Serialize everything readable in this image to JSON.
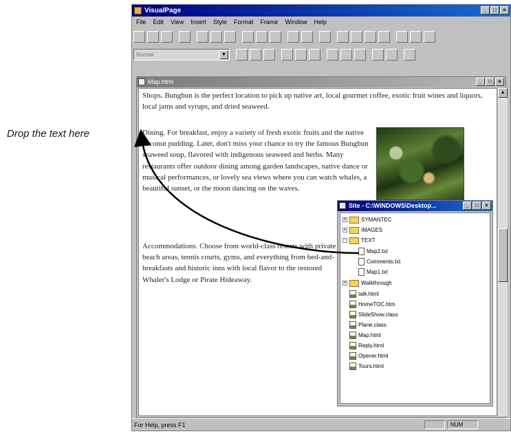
{
  "caption": "Drop the text here",
  "app": {
    "title": "VisualPage",
    "window_buttons": [
      "_",
      "□",
      "×"
    ],
    "menu": [
      "File",
      "Edit",
      "View",
      "Insert",
      "Style",
      "Format",
      "Frame",
      "Window",
      "Help"
    ],
    "style_combo_value": "Normal"
  },
  "document": {
    "title": "Map.html",
    "paragraphs": [
      "Shops. Bungbun is the perfect location to pick up native art, local gourmet coffee, exotic fruit wines and liquors, local jams and syrups, and dried seaweed.",
      "Dining. For breakfast, enjoy a variety of fresh exotic fruits and the native coconut pudding. Later, don't miss your chance to try the famous Bungbun seaweed soup, flavored with indigenous seaweed and herbs. Many restaurants offer outdoor dining among garden landscapes, native dance or musical performances, or lovely sea views where you can watch whales, a beautiful sunset, or the moon dancing on the waves.",
      "Accommodations. Choose from world-class resorts with private beach areas, tennis courts, gyms, and everything from bed-and-breakfasts and historic inns with local flavor to the restored Whaler's Lodge or Pirate Hideaway."
    ]
  },
  "site": {
    "title": "Site - C:\\WINDOWS\\Desktop...",
    "tree": [
      {
        "label": "SYMANTEC",
        "type": "folder",
        "expander": "+",
        "depth": 0
      },
      {
        "label": "IMAGES",
        "type": "folder",
        "expander": "+",
        "depth": 0
      },
      {
        "label": "TEXT",
        "type": "folder",
        "expander": "-",
        "depth": 0
      },
      {
        "label": "Map2.txt",
        "type": "file",
        "expander": "",
        "depth": 1
      },
      {
        "label": "Comments.txt",
        "type": "file",
        "expander": "",
        "depth": 1
      },
      {
        "label": "Map1.txt",
        "type": "file",
        "expander": "",
        "depth": 1
      },
      {
        "label": "Walkthrough",
        "type": "folder",
        "expander": "+",
        "depth": 0
      },
      {
        "label": "talk.html",
        "type": "page",
        "expander": "",
        "depth": 0
      },
      {
        "label": "HomeTOC.htm",
        "type": "page",
        "expander": "",
        "depth": 0
      },
      {
        "label": "SlideShow.class",
        "type": "page",
        "expander": "",
        "depth": 0
      },
      {
        "label": "Plane.class",
        "type": "page",
        "expander": "",
        "depth": 0
      },
      {
        "label": "Map.html",
        "type": "page",
        "expander": "",
        "depth": 0
      },
      {
        "label": "Reply.html",
        "type": "page",
        "expander": "",
        "depth": 0
      },
      {
        "label": "Opener.html",
        "type": "page",
        "expander": "",
        "depth": 0
      },
      {
        "label": "Tours.html",
        "type": "page",
        "expander": "",
        "depth": 0
      }
    ]
  },
  "status": {
    "help_text": "For Help, press F1",
    "num_indicator": "NUM"
  },
  "colors": {
    "title_active": "#00007b",
    "title_inactive": "#7b7b7b",
    "face": "#c0c0c0"
  }
}
